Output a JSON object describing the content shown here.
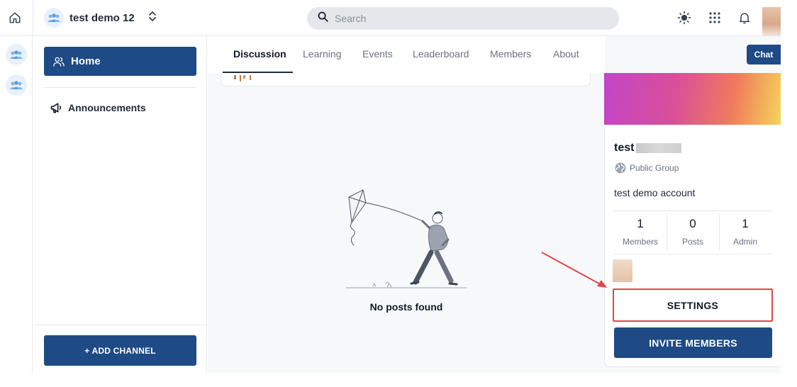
{
  "header": {
    "group_name": "test demo 12",
    "search_placeholder": "Search"
  },
  "sidebar": {
    "home_label": "Home",
    "announcements_label": "Announcements",
    "add_channel_label": "+ ADD CHANNEL"
  },
  "tabs": [
    {
      "label": "Discussion",
      "active": true
    },
    {
      "label": "Learning",
      "active": false
    },
    {
      "label": "Events",
      "active": false
    },
    {
      "label": "Leaderboard",
      "active": false
    },
    {
      "label": "Members",
      "active": false
    },
    {
      "label": "About",
      "active": false
    }
  ],
  "main": {
    "empty_text": "No posts found",
    "chat_label": "Chat"
  },
  "group_card": {
    "title": "test",
    "type": "Public Group",
    "description": "test demo account",
    "stats": [
      {
        "value": "1",
        "label": "Members"
      },
      {
        "value": "0",
        "label": "Posts"
      },
      {
        "value": "1",
        "label": "Admin"
      }
    ],
    "settings_label": "SETTINGS",
    "invite_label": "INVITE MEMBERS"
  },
  "colors": {
    "primary": "#1e4a85",
    "highlight": "#e04848"
  }
}
